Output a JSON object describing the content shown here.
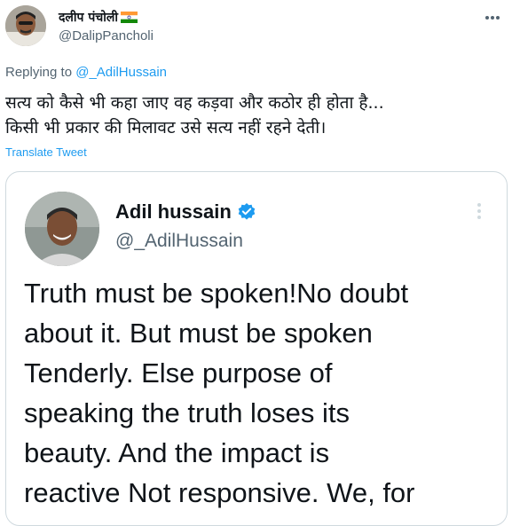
{
  "tweet": {
    "author_name": "दलीप पंचोली",
    "author_handle": "@DalipPancholi",
    "replying_prefix": "Replying to",
    "replying_to": "@_AdilHussain",
    "text_line1": "सत्य को कैसे भी कहा जाए वह कड़वा और कठोर ही होता है...",
    "text_line2": "किसी भी प्रकार की मिलावट उसे सत्य नहीं रहने देती।",
    "translate_label": "Translate Tweet",
    "more_icon": "more-horizontal-icon",
    "flag_icon": "india-flag-icon"
  },
  "quoted": {
    "author_name": "Adil hussain",
    "author_handle": "@_AdilHussain",
    "verified_icon": "verified-badge-icon",
    "more_icon": "more-vertical-icon",
    "text_lines": [
      "Truth must be spoken!No doubt",
      "about it. But must be spoken",
      "Tenderly. Else purpose of",
      "speaking the truth loses its",
      "beauty. And the impact is",
      "reactive Not responsive. We, for"
    ]
  },
  "colors": {
    "link": "#1d9bf0",
    "secondary_text": "#536471",
    "border": "#cfd9de",
    "text": "#0f1419"
  }
}
